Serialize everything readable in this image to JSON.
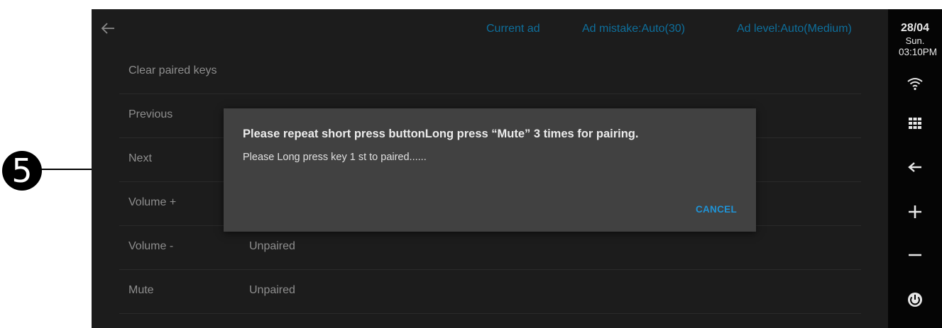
{
  "callout": {
    "number": "5"
  },
  "topbar": {
    "back_icon": "arrow-left-icon",
    "current_ad": "Current ad",
    "ad_mistake": "Ad mistake:Auto(30)",
    "ad_level": "Ad level:Auto(Medium)"
  },
  "list": {
    "items": [
      {
        "label": "Clear paired keys",
        "status": ""
      },
      {
        "label": "Previous",
        "status": ""
      },
      {
        "label": "Next",
        "status": ""
      },
      {
        "label": "Volume +",
        "status": ""
      },
      {
        "label": "Volume -",
        "status": "Unpaired"
      },
      {
        "label": "Mute",
        "status": "Unpaired"
      }
    ]
  },
  "dialog": {
    "title": "Please repeat short press buttonLong press “Mute” 3 times for pairing.",
    "message": "Please Long press key 1 st to paired......",
    "cancel_label": "CANCEL"
  },
  "side": {
    "date": "28/04",
    "day": "Sun.",
    "time": "03:10PM",
    "icons": [
      "wifi-icon",
      "apps-grid-icon",
      "back-arrow-icon",
      "volume-up-icon",
      "volume-down-icon",
      "power-icon"
    ]
  },
  "colors": {
    "screen_bg": "#1c1c1c",
    "dialog_bg": "#414141",
    "accent": "#1f93d6",
    "topbar_link": "#0e6f9c",
    "side_bg": "#050505"
  }
}
